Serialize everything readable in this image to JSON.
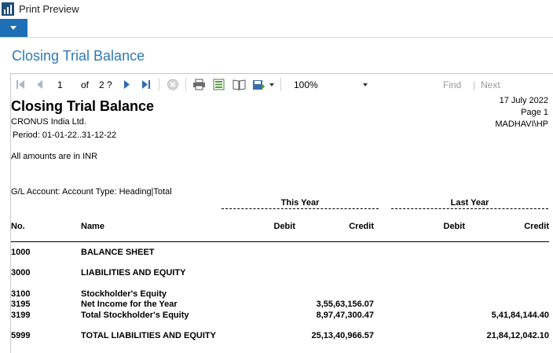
{
  "window": {
    "title": "Print Preview"
  },
  "ribbon": {
    "menu_icon": "chevron-down-icon"
  },
  "page": {
    "heading": "Closing Trial Balance"
  },
  "toolbar": {
    "current_page": "1",
    "of_label": "of",
    "total_pages": "2 ?",
    "zoom": "100%",
    "search_value": "",
    "find_label": "Find",
    "separator": "|",
    "next_label": "Next",
    "icons": [
      "first-page-icon",
      "previous-page-icon",
      "next-page-icon",
      "last-page-icon",
      "stop-icon",
      "print-icon",
      "print-layout-icon",
      "page-setup-icon",
      "export-icon"
    ]
  },
  "report": {
    "title": "Closing Trial Balance",
    "company": "CRONUS India Ltd.",
    "period": "Period: 01-01-22..31-12-22",
    "date": "17 July 2022",
    "page": "Page 1",
    "user": "MADHAVI\\HP",
    "currency_note": "All amounts are in INR",
    "filter": "G/L Account: Account Type: Heading|Total",
    "groups": {
      "this_year": "This Year",
      "last_year": "Last Year"
    },
    "columns": {
      "no": "No.",
      "name": "Name",
      "ty_debit": "Debit",
      "ty_credit": "Credit",
      "ly_debit": "Debit",
      "ly_credit": "Credit"
    },
    "rows": [
      {
        "no": "1000",
        "name": "BALANCE SHEET",
        "ty_debit": "",
        "ty_credit": "",
        "ly_debit": "",
        "ly_credit": ""
      },
      {
        "no": "3000",
        "name": "LIABILITIES AND EQUITY",
        "ty_debit": "",
        "ty_credit": "",
        "ly_debit": "",
        "ly_credit": ""
      },
      {
        "no": "3100",
        "name": "Stockholder's Equity",
        "ty_debit": "",
        "ty_credit": "",
        "ly_debit": "",
        "ly_credit": ""
      },
      {
        "no": "3195",
        "name": "Net Income for the Year",
        "ty_debit": "",
        "ty_credit": "3,55,63,156.07",
        "ly_debit": "",
        "ly_credit": ""
      },
      {
        "no": "3199",
        "name": "Total Stockholder's Equity",
        "ty_debit": "",
        "ty_credit": "8,97,47,300.47",
        "ly_debit": "",
        "ly_credit": "5,41,84,144.40"
      },
      {
        "no": "5999",
        "name": "TOTAL LIABILITIES AND EQUITY",
        "ty_debit": "",
        "ty_credit": "25,13,40,966.57",
        "ly_debit": "",
        "ly_credit": "21,84,12,042.10"
      }
    ]
  },
  "colors": {
    "accent": "#1e6fb5",
    "heading": "#2f78b5",
    "disabled_text": "#9a9a9a"
  }
}
